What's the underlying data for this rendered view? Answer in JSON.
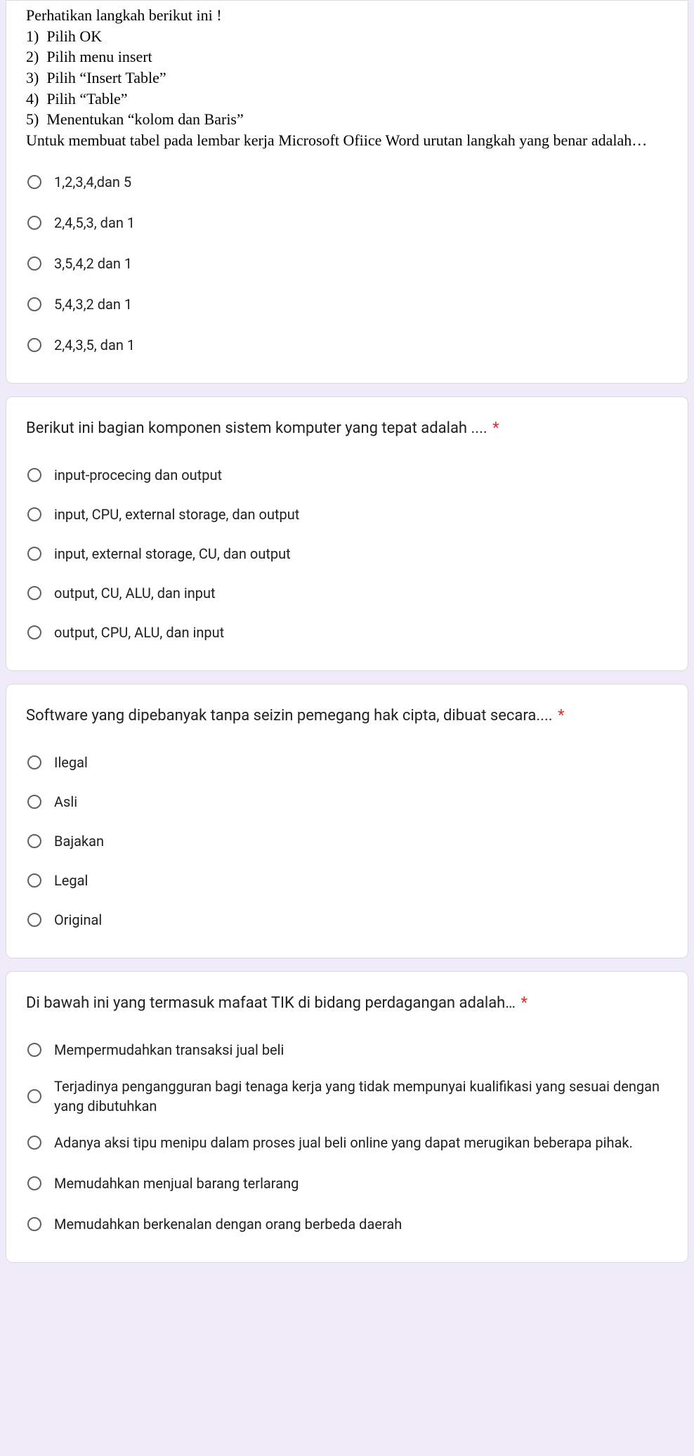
{
  "q1": {
    "stem_lines": [
      "Perhatikan langkah berikut ini !",
      "1)  Pilih OK",
      "2)  Pilih menu insert",
      "3)  Pilih “Insert Table”",
      "4)  Pilih “Table”",
      "5)  Menentukan “kolom dan Baris”",
      "Untuk membuat tabel pada lembar kerja Microsoft Ofiice Word urutan langkah yang benar adalah…"
    ],
    "options": [
      "1,2,3,4,dan 5",
      "2,4,5,3, dan 1",
      "3,5,4,2 dan 1",
      "5,4,3,2 dan 1",
      "2,4,3,5, dan 1"
    ]
  },
  "q2": {
    "title": "Berikut ini bagian komponen sistem komputer yang tepat adalah ....",
    "required": "*",
    "options": [
      "input-procecing dan output",
      "input, CPU, external storage, dan output",
      "input, external storage, CU, dan output",
      "output, CU, ALU, dan input",
      "output, CPU, ALU, dan input"
    ]
  },
  "q3": {
    "title": "Software yang dipebanyak tanpa seizin pemegang hak cipta, dibuat secara....",
    "required": "*",
    "options": [
      "Ilegal",
      "Asli",
      "Bajakan",
      "Legal",
      "Original"
    ]
  },
  "q4": {
    "title": "Di bawah ini yang termasuk mafaat TIK di bidang perdagangan adalah…",
    "required": "*",
    "options": [
      "Mempermudahkan transaksi jual beli",
      "Terjadinya pengangguran bagi tenaga kerja yang tidak mempunyai kualifikasi yang sesuai dengan yang dibutuhkan",
      "Adanya aksi tipu menipu dalam proses jual beli online yang dapat merugikan beberapa pihak.",
      "Memudahkan menjual barang terlarang",
      "Memudahkan berkenalan dengan orang berbeda daerah"
    ]
  }
}
